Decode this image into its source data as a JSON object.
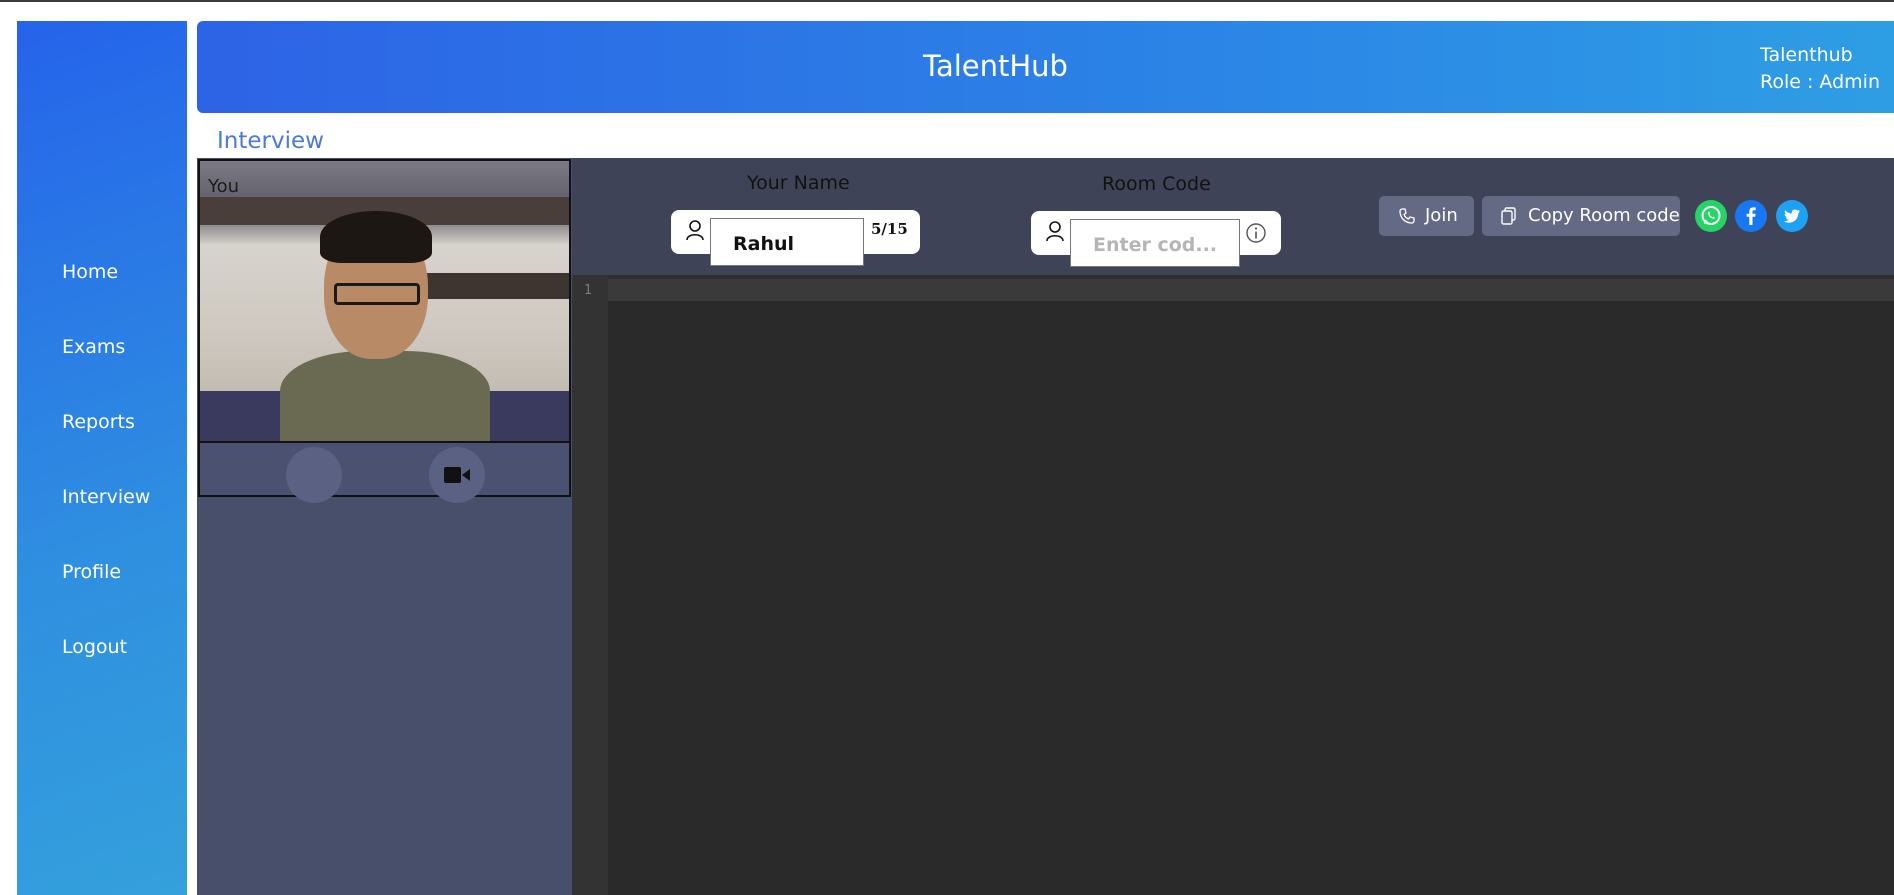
{
  "app": {
    "brand": "TalentHub"
  },
  "user": {
    "name": "Talenthub",
    "role": "Role : Admin"
  },
  "sidebar": {
    "items": [
      {
        "label": "Home"
      },
      {
        "label": "Exams"
      },
      {
        "label": "Reports"
      },
      {
        "label": "Interview"
      },
      {
        "label": "Profile"
      },
      {
        "label": "Logout"
      }
    ]
  },
  "page": {
    "title": "Interview"
  },
  "video": {
    "self_label": "You"
  },
  "form": {
    "name_label": "Your Name",
    "name_value": "Rahul",
    "name_counter": "5/15",
    "room_label": "Room Code",
    "room_placeholder": "Enter cod..."
  },
  "actions": {
    "join_label": "Join",
    "copy_label": "Copy Room code"
  },
  "share": [
    {
      "icon": "whatsapp-icon",
      "color": "#25d366"
    },
    {
      "icon": "facebook-icon",
      "color": "#1877f2"
    },
    {
      "icon": "twitter-icon",
      "color": "#1da1f2"
    }
  ],
  "editor": {
    "line_numbers": [
      "1"
    ]
  }
}
